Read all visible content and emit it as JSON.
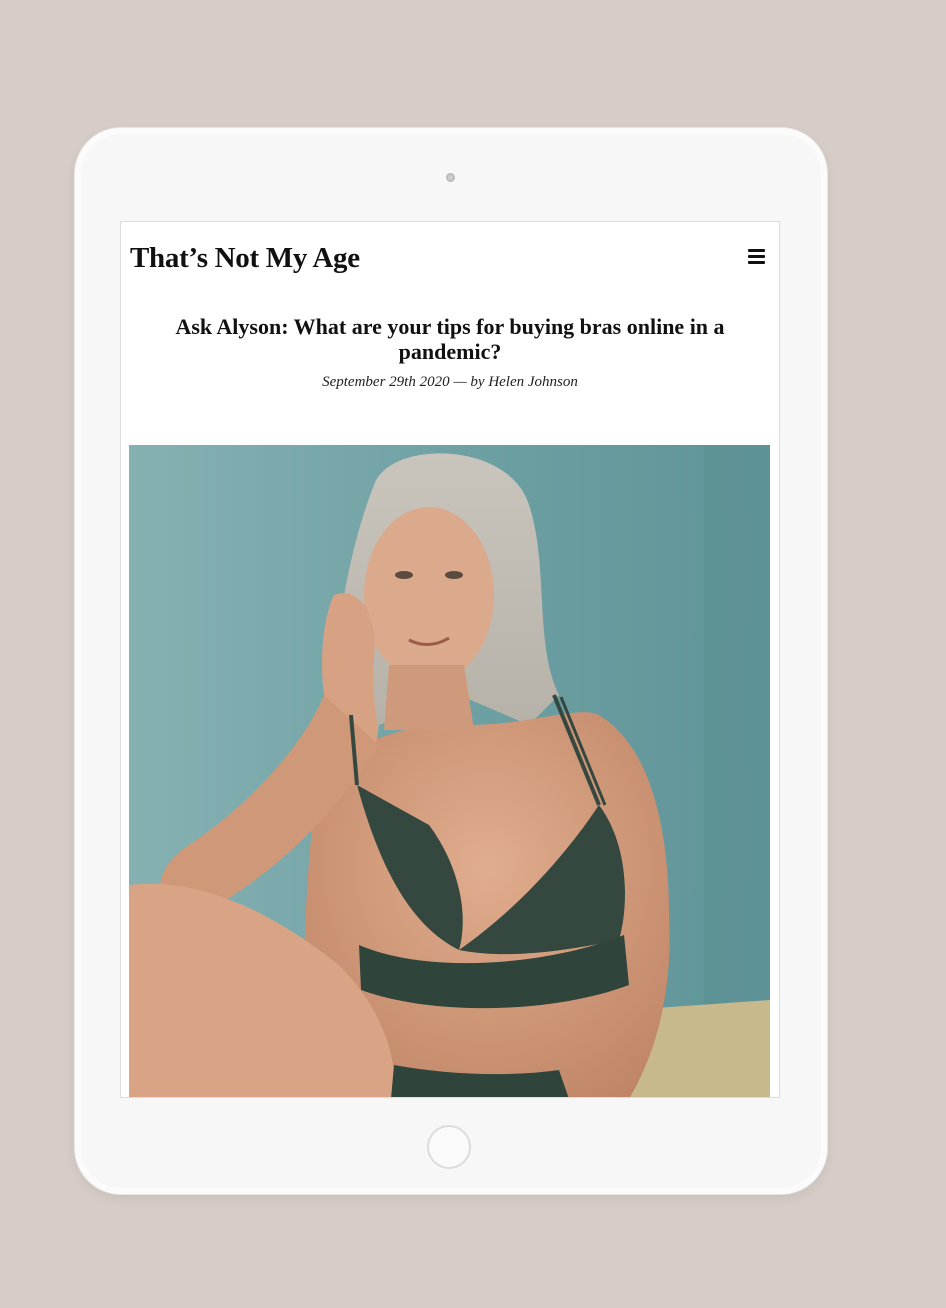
{
  "site": {
    "title": "That’s Not My Age"
  },
  "article": {
    "title": "Ask Alyson: What are your tips for buying bras online in a pandemic?",
    "byline": "September 29th 2020 — by Helen Johnson"
  },
  "icons": {
    "menu": "hamburger-menu-icon"
  },
  "colors": {
    "background": "#d7cdc8",
    "device": "#f7f7f7",
    "photo_backdrop": "#6f9fa2",
    "bra": "#34483f"
  }
}
